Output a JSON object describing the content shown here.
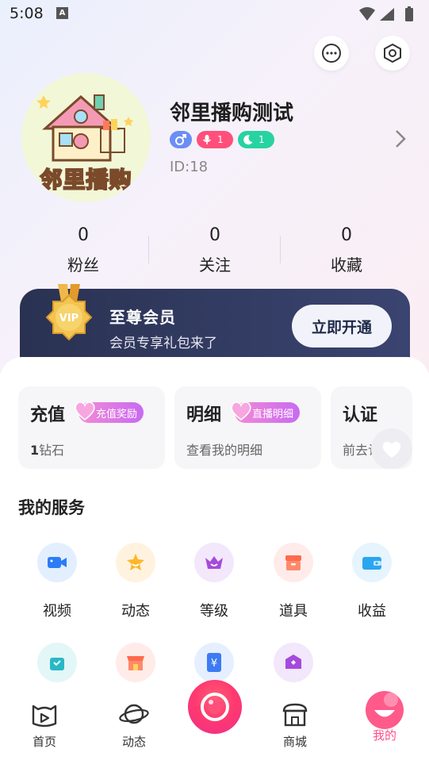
{
  "status_bar": {
    "time": "5:08",
    "notif_icon": "A"
  },
  "header": {
    "message_icon": "chat-bubble-icon",
    "settings_icon": "hexagon-settings-icon"
  },
  "profile": {
    "avatar_text": "邻里播购",
    "name": "邻里播购测试",
    "badges": [
      {
        "icon": "male",
        "value": "",
        "color": "#6b8ef5"
      },
      {
        "icon": "mic",
        "value": "1",
        "color": "#ff4f7a"
      },
      {
        "icon": "moon",
        "value": "1",
        "color": "#27d3a0"
      }
    ],
    "id_text": "ID:18"
  },
  "stats": [
    {
      "count": "0",
      "label": "粉丝"
    },
    {
      "count": "0",
      "label": "关注"
    },
    {
      "count": "0",
      "label": "收藏"
    }
  ],
  "vip": {
    "medal_text": "VIP",
    "title": "至尊会员",
    "subtitle": "会员专享礼包来了",
    "button": "立即开通"
  },
  "cards": [
    {
      "title": "充值",
      "tag": "充值奖励",
      "sub_strong": "1",
      "sub": "钻石"
    },
    {
      "title": "明细",
      "tag": "直播明细",
      "sub_strong": "",
      "sub": "查看我的明细"
    },
    {
      "title": "认证",
      "tag": "",
      "sub_strong": "",
      "sub": "前去认证"
    }
  ],
  "services": {
    "title": "我的服务",
    "items": [
      {
        "label": "视频",
        "icon": "video-camera-icon",
        "bg": "#e3efff",
        "color": "#2b7cf6"
      },
      {
        "label": "动态",
        "icon": "star-icon",
        "bg": "#fff3e0",
        "color": "#ffb629"
      },
      {
        "label": "等级",
        "icon": "crown-icon",
        "bg": "#f3e8fb",
        "color": "#a54bdc"
      },
      {
        "label": "道具",
        "icon": "box-icon",
        "bg": "#ffecea",
        "color": "#ff6a4d"
      },
      {
        "label": "收益",
        "icon": "wallet-icon",
        "bg": "#e6f4fd",
        "color": "#2aa6f0"
      },
      {
        "label": "",
        "icon": "shopping-bag-icon",
        "bg": "#e3f6f8",
        "color": "#28b8c6"
      },
      {
        "label": "",
        "icon": "shop-icon",
        "bg": "#ffece8",
        "color": "#ff6a4d"
      },
      {
        "label": "",
        "icon": "yen-ticket-icon",
        "bg": "#e6efff",
        "color": "#3d7bf2"
      },
      {
        "label": "",
        "icon": "home-badge-icon",
        "bg": "#f2e7fb",
        "color": "#a54bdc"
      }
    ]
  },
  "bottom_nav": [
    {
      "label": "首页",
      "icon": "home-icon",
      "active": false
    },
    {
      "label": "动态",
      "icon": "planet-icon",
      "active": false
    },
    {
      "label": "",
      "icon": "live-camera-icon",
      "active": false
    },
    {
      "label": "商城",
      "icon": "mall-icon",
      "active": false
    },
    {
      "label": "我的",
      "icon": "smile-face-icon",
      "active": true
    }
  ],
  "colors": {
    "accent": "#ff4f8a",
    "vip_bg": "#2a3252"
  }
}
